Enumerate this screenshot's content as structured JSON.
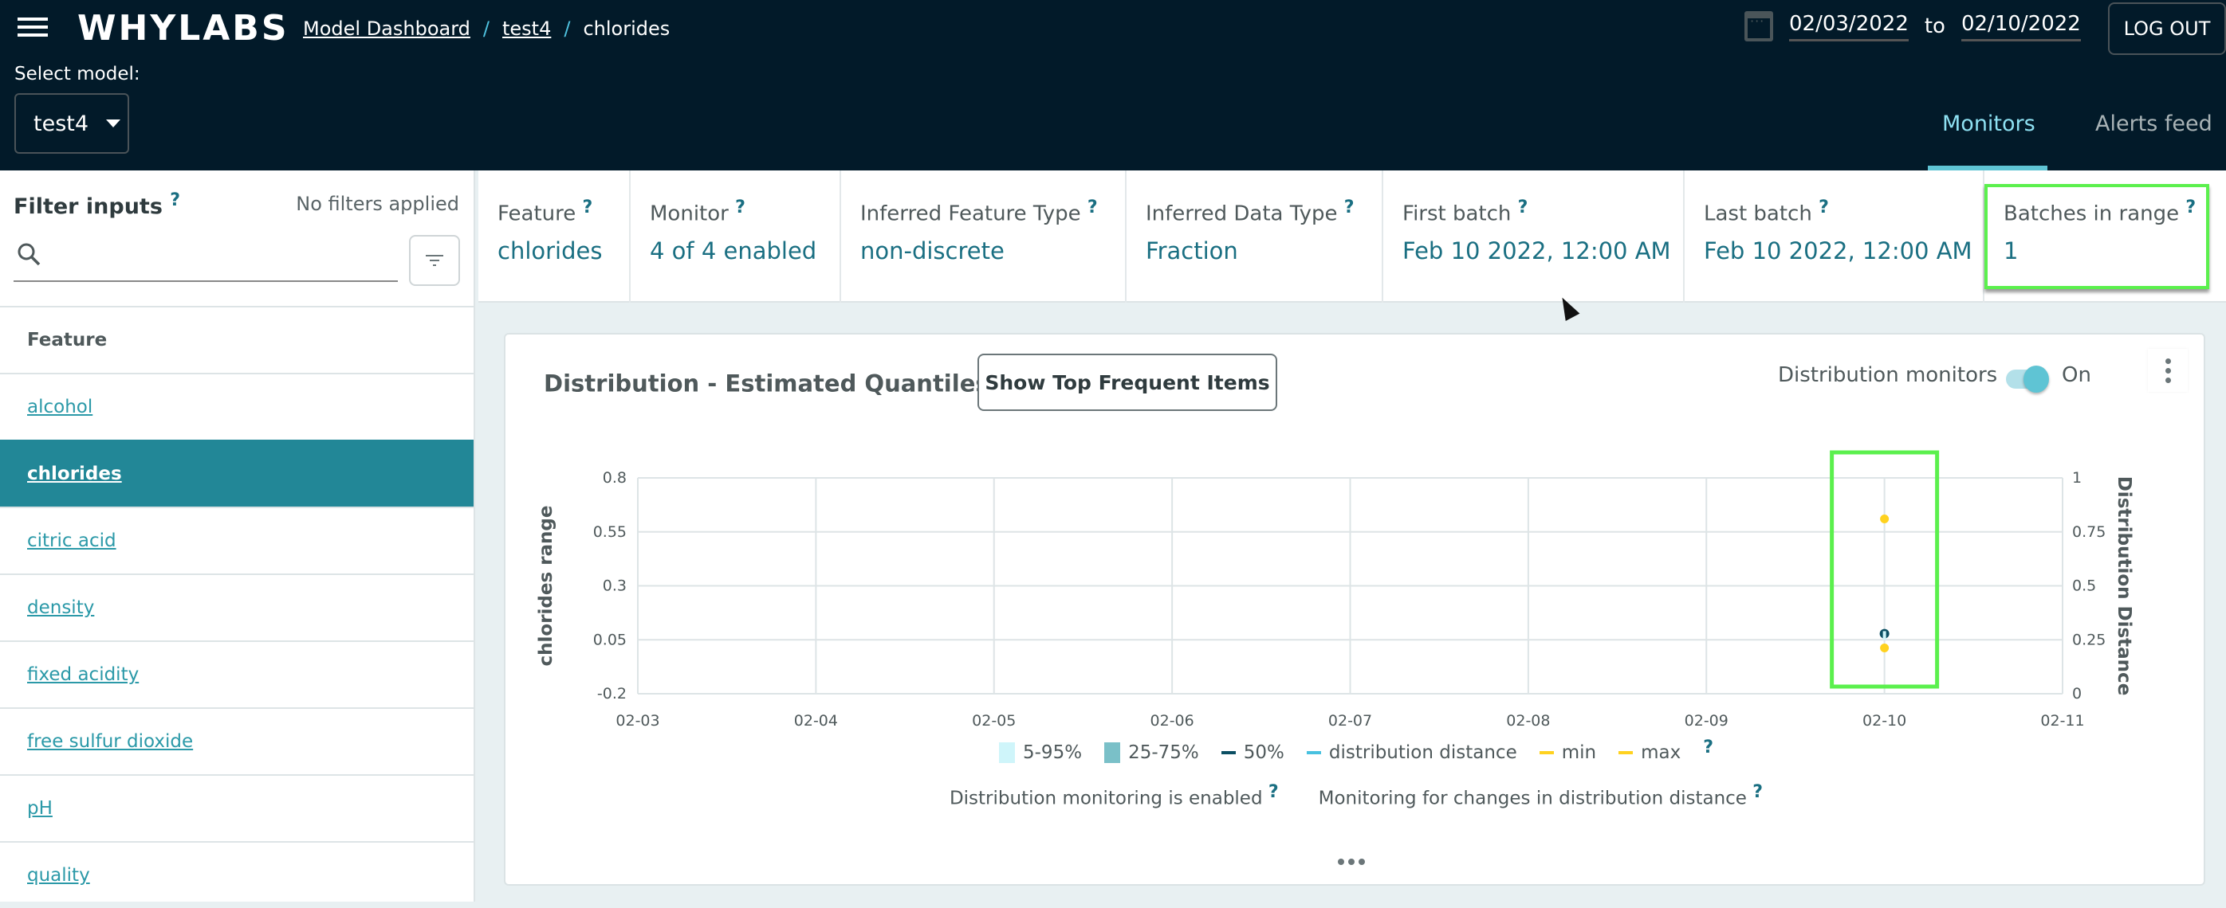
{
  "header": {
    "logo": "WHYLABS",
    "breadcrumbs": [
      {
        "label": "Model Dashboard",
        "link": true
      },
      {
        "label": "test4",
        "link": true
      },
      {
        "label": "chlorides",
        "link": false
      }
    ],
    "separator": "/",
    "select_model_label": "Select model:",
    "selected_model": "test4",
    "date_from": "02/03/2022",
    "date_to_label": "to",
    "date_to": "02/10/2022",
    "logout_label": "LOG OUT",
    "tabs": [
      {
        "label": "Monitors",
        "active": true
      },
      {
        "label": "Alerts feed",
        "active": false
      }
    ]
  },
  "filter": {
    "title": "Filter inputs",
    "help": "?",
    "status": "No filters applied",
    "search_value": "",
    "search_placeholder": ""
  },
  "features": {
    "header": "Feature",
    "items": [
      {
        "label": "alcohol",
        "active": false
      },
      {
        "label": "chlorides",
        "active": true
      },
      {
        "label": "citric acid",
        "active": false
      },
      {
        "label": "density",
        "active": false
      },
      {
        "label": "fixed acidity",
        "active": false
      },
      {
        "label": "free sulfur dioxide",
        "active": false
      },
      {
        "label": "pH",
        "active": false
      },
      {
        "label": "quality",
        "active": false
      }
    ]
  },
  "summary": [
    {
      "label": "Feature",
      "value": "chlorides"
    },
    {
      "label": "Monitor",
      "value": "4 of 4 enabled"
    },
    {
      "label": "Inferred Feature Type",
      "value": "non-discrete"
    },
    {
      "label": "Inferred Data Type",
      "value": "Fraction"
    },
    {
      "label": "First batch",
      "value": "Feb 10 2022, 12:00 AM"
    },
    {
      "label": "Last batch",
      "value": "Feb 10 2022, 12:00 AM"
    },
    {
      "label": "Batches in range",
      "value": "1"
    }
  ],
  "card": {
    "title": "Distribution - Estimated Quantiles",
    "help": "?",
    "top_items_button": "Show Top Frequent Items",
    "toggle_label": "Distribution monitors",
    "toggle_state": "On",
    "toggle_on": true,
    "legend": [
      {
        "label": "5-95%",
        "kind": "box",
        "color": "#cff5fa"
      },
      {
        "label": "25-75%",
        "kind": "box",
        "color": "#7ac0c8"
      },
      {
        "label": "50%",
        "kind": "line",
        "color": "#0b4f63"
      },
      {
        "label": "distribution distance",
        "kind": "line",
        "color": "#48c1e0"
      },
      {
        "label": "min",
        "kind": "line",
        "color": "#ffd21f"
      },
      {
        "label": "max",
        "kind": "line",
        "color": "#ffd21f"
      }
    ],
    "notes": [
      "Distribution monitoring is enabled",
      "Monitoring for changes in distribution distance"
    ]
  },
  "chart_data": {
    "type": "scatter",
    "title": "Distribution - Estimated Quantiles",
    "x": [
      "02-03",
      "02-04",
      "02-05",
      "02-06",
      "02-07",
      "02-08",
      "02-09",
      "02-10",
      "02-11"
    ],
    "ylabel": "chlorides range",
    "y2label": "Distribution Distance",
    "ylim": [
      -0.2,
      0.8
    ],
    "yticks": [
      "0.8",
      "0.55",
      "0.3",
      "0.05",
      "-0.2"
    ],
    "y2lim": [
      0,
      1
    ],
    "y2ticks": [
      "1",
      "0.75",
      "0.5",
      "0.25",
      "0"
    ],
    "grid": true,
    "legend_position": "bottom",
    "series": [
      {
        "name": "max",
        "color": "#ffd21f",
        "points": [
          {
            "x": "02-10",
            "y": 0.61
          }
        ]
      },
      {
        "name": "50%",
        "color": "#0b4f63",
        "points": [
          {
            "x": "02-10",
            "y": 0.078
          }
        ]
      },
      {
        "name": "min",
        "color": "#ffd21f",
        "points": [
          {
            "x": "02-10",
            "y": 0.012
          }
        ]
      },
      {
        "name": "5-95%",
        "color": "#cff5fa",
        "points": [
          {
            "x": "02-10",
            "low": 0.05,
            "high": 0.09
          }
        ]
      }
    ],
    "highlighted_x": "02-10"
  }
}
